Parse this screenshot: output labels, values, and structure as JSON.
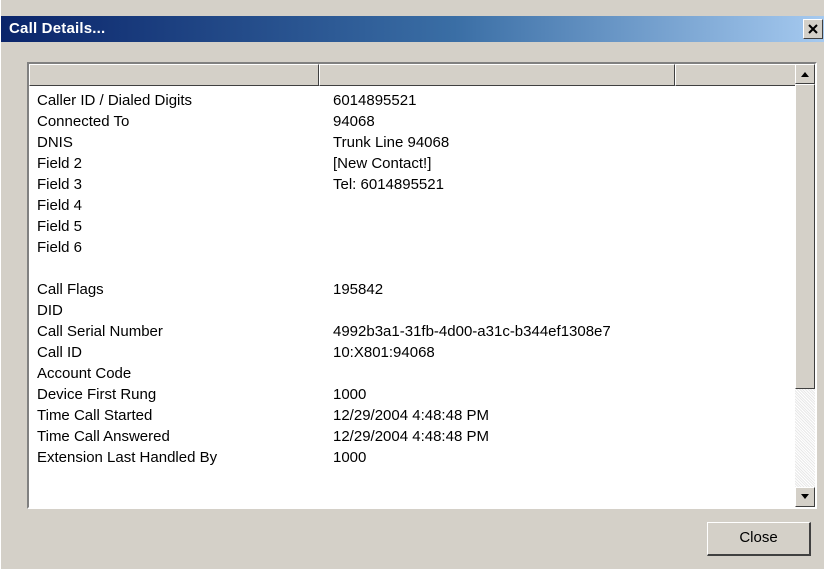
{
  "window": {
    "title": "Call Details...",
    "close_glyph": "✕"
  },
  "listview": {
    "columns": [
      "",
      "",
      ""
    ],
    "rows": [
      {
        "label": "Caller ID / Dialed Digits",
        "value": "6014895521"
      },
      {
        "label": "Connected To",
        "value": "94068"
      },
      {
        "label": "DNIS",
        "value": "Trunk Line 94068"
      },
      {
        "label": "Field 2",
        "value": "[New Contact!]"
      },
      {
        "label": "Field 3",
        "value": "Tel: 6014895521"
      },
      {
        "label": "Field 4",
        "value": ""
      },
      {
        "label": "Field 5",
        "value": ""
      },
      {
        "label": "Field 6",
        "value": ""
      },
      {
        "label": "",
        "value": ""
      },
      {
        "label": "Call Flags",
        "value": "195842"
      },
      {
        "label": "DID",
        "value": ""
      },
      {
        "label": "Call Serial Number",
        "value": "4992b3a1-31fb-4d00-a31c-b344ef1308e7"
      },
      {
        "label": "Call ID",
        "value": "10:X801:94068"
      },
      {
        "label": "Account Code",
        "value": ""
      },
      {
        "label": "Device First Rung",
        "value": "1000"
      },
      {
        "label": "Time Call Started",
        "value": "12/29/2004 4:48:48 PM"
      },
      {
        "label": "Time Call Answered",
        "value": "12/29/2004 4:48:48 PM"
      },
      {
        "label": "Extension Last Handled By",
        "value": "1000"
      }
    ]
  },
  "scrollbar": {
    "up_icon": "triangle-up",
    "down_icon": "triangle-down"
  },
  "buttons": {
    "close_label": "Close"
  }
}
